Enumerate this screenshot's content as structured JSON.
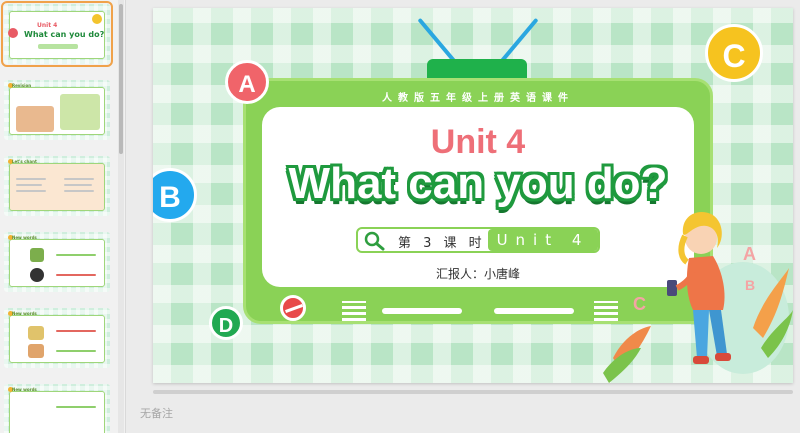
{
  "thumbnails": [
    {
      "index": 1,
      "title1": "Unit 4",
      "title2": "What can you do?",
      "active": true
    },
    {
      "index": 2,
      "header": "Revision"
    },
    {
      "index": 3,
      "header": "Let's chant"
    },
    {
      "index": 4,
      "header": "New words"
    },
    {
      "index": 5,
      "header": "New words"
    },
    {
      "index": 6,
      "header": "New words"
    }
  ],
  "slide": {
    "band_text": "人教版五年级上册英语课件",
    "unit_title": "Unit 4",
    "main_title": "What can you do?",
    "lesson_text": "第 3 课 时",
    "lesson_unit": "Unit 4",
    "presenter": "汇报人：小唐峰",
    "letters": [
      "A",
      "B",
      "C",
      "D"
    ]
  },
  "notes": {
    "placeholder": "无备注"
  },
  "colors": {
    "accent_green": "#8ad256",
    "title_pink": "#ee6f78",
    "title_green": "#1f9a3e",
    "highlight": "#f0a24a"
  },
  "icons": [
    "search-icon",
    "speaker-grille-icon",
    "power-knob-icon"
  ]
}
